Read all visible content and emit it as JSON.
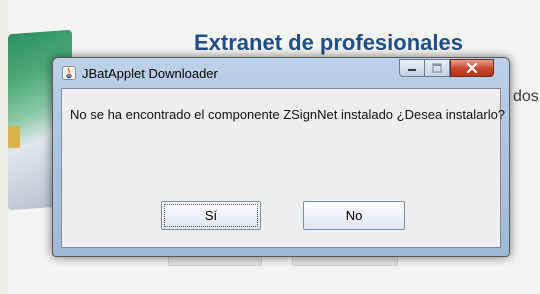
{
  "background_page": {
    "title": "Extranet de profesionales",
    "side_text": "dos c"
  },
  "dialog": {
    "title": "JBatApplet Downloader",
    "icon": "java-icon",
    "controls": {
      "minimize_icon": "minimize-icon",
      "maximize_icon": "maximize-icon",
      "close_icon": "close-icon"
    },
    "message": "No se ha encontrado el componente ZSignNet instalado ¿Desea instalarlo?",
    "buttons": {
      "yes_label": "Sí",
      "no_label": "No"
    }
  },
  "colors": {
    "title_text": "#1f4f86",
    "close_button": "#c8452b",
    "dialog_frame": "#bcd1e8"
  }
}
